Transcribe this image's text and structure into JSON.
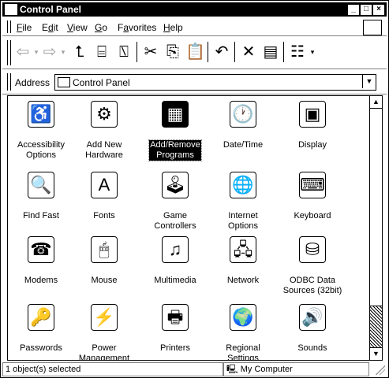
{
  "window": {
    "title": "Control Panel"
  },
  "menu": [
    {
      "label": "File"
    },
    {
      "label": "Edit"
    },
    {
      "label": "View"
    },
    {
      "label": "Go"
    },
    {
      "label": "Favorites"
    },
    {
      "label": "Help"
    }
  ],
  "toolbar": {
    "back_icon": "arrow-left-icon",
    "forward_icon": "arrow-right-icon",
    "up_icon": "folder-up-icon",
    "map_drive_icon": "map-drive-icon",
    "disconnect_icon": "disconnect-drive-icon",
    "cut_icon": "scissors-icon",
    "copy_icon": "copy-icon",
    "paste_icon": "paste-icon",
    "undo_icon": "undo-icon",
    "delete_icon": "delete-x-icon",
    "properties_icon": "properties-icon",
    "views_icon": "views-icon"
  },
  "address": {
    "label": "Address",
    "value": "Control Panel"
  },
  "items": [
    {
      "label": "Accessibility\nOptions",
      "glyph": "♿"
    },
    {
      "label": "Add New\nHardware",
      "glyph": "⚙"
    },
    {
      "label": "Add/Remove\nPrograms",
      "glyph": "▦"
    },
    {
      "label": "Date/Time",
      "glyph": "🕐"
    },
    {
      "label": "Display",
      "glyph": "▣"
    },
    {
      "label": "Find Fast",
      "glyph": "🔍"
    },
    {
      "label": "Fonts",
      "glyph": "A"
    },
    {
      "label": "Game\nControllers",
      "glyph": "🕹"
    },
    {
      "label": "Internet\nOptions",
      "glyph": "🌐"
    },
    {
      "label": "Keyboard",
      "glyph": "⌨"
    },
    {
      "label": "Modems",
      "glyph": "☎"
    },
    {
      "label": "Mouse",
      "glyph": "🖱"
    },
    {
      "label": "Multimedia",
      "glyph": "♫"
    },
    {
      "label": "Network",
      "glyph": "🖧"
    },
    {
      "label": "ODBC Data\nSources (32bit)",
      "glyph": "⛁"
    },
    {
      "label": "Passwords",
      "glyph": "🔑"
    },
    {
      "label": "Power\nManagement",
      "glyph": "⚡"
    },
    {
      "label": "Printers",
      "glyph": "🖶"
    },
    {
      "label": "Regional\nSettings",
      "glyph": "🌍"
    },
    {
      "label": "Sounds",
      "glyph": "🔊"
    }
  ],
  "selected_item": "Add/Remove\nPrograms",
  "status": {
    "left": "1 object(s) selected",
    "zone": "My Computer"
  }
}
